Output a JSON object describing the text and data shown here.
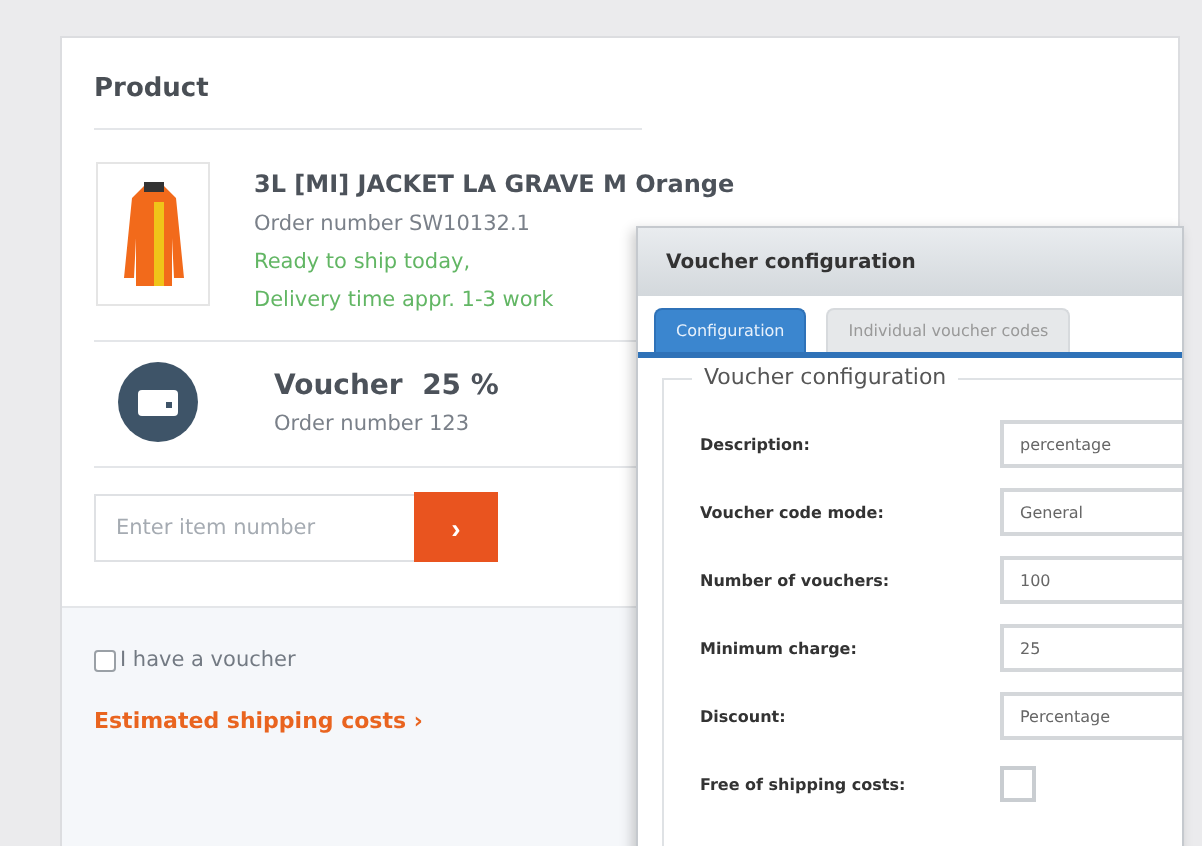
{
  "product_section": {
    "title": "Product",
    "item": {
      "name": "3L [MI] JACKET LA GRAVE M Orange",
      "order_number": "Order number SW10132.1",
      "availability": "Ready to ship today,",
      "delivery": "Delivery time appr. 1-3 work"
    },
    "voucher": {
      "name": "Voucher  25 %",
      "order_number": "Order number 123"
    },
    "item_input": {
      "placeholder": "Enter item number",
      "button": "›"
    },
    "voucher_checkbox": {
      "label": "I have a voucher",
      "checked": false
    },
    "shipping_link": "Estimated shipping costs ›"
  },
  "dialog": {
    "title": "Voucher configuration",
    "tabs": [
      {
        "label": "Configuration",
        "selected": true
      },
      {
        "label": "Individual voucher codes",
        "selected": false
      }
    ],
    "fieldset_title": "Voucher configuration",
    "fields": [
      {
        "label": "Description:",
        "kind": "text",
        "value": "percentage"
      },
      {
        "label": "Voucher code mode:",
        "kind": "select",
        "value": "General"
      },
      {
        "label": "Number of vouchers:",
        "kind": "text",
        "value": "100"
      },
      {
        "label": "Minimum charge:",
        "kind": "text",
        "value": "25"
      },
      {
        "label": "Discount:",
        "kind": "select",
        "value": "Percentage"
      },
      {
        "label": "Free of shipping costs:",
        "kind": "checkbox",
        "checked": false
      }
    ]
  }
}
